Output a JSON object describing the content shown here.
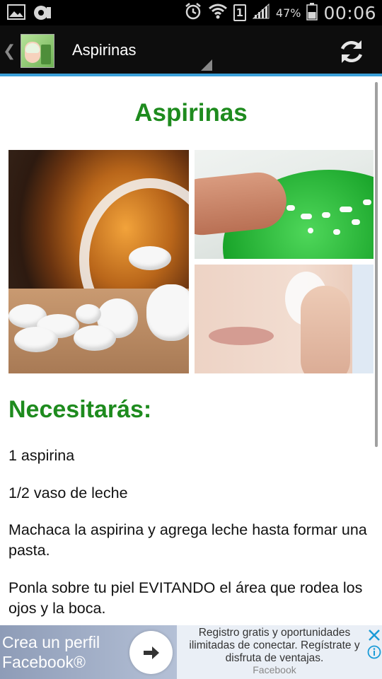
{
  "status_bar": {
    "time": "00:06",
    "battery_percent": "47%",
    "sim_slot": "1"
  },
  "action_bar": {
    "title": "Aspirinas"
  },
  "article": {
    "title": "Aspirinas",
    "section_heading": "Necesitarás:",
    "paragraphs": [
      "1 aspirina",
      "1/2 vaso de leche",
      "Machaca la aspirina y agrega leche hasta formar una pasta.",
      "Ponla sobre tu piel EVITANDO el área que rodea los ojos y la boca."
    ]
  },
  "ad": {
    "cta_line1": "Crea un perfil",
    "cta_line2": "Facebook®",
    "description": "Registro gratis y oportunidades ilimitadas de conectar. Regístrate y disfruta de ventajas.",
    "source": "Facebook"
  },
  "colors": {
    "accent_green": "#1e8b1e",
    "action_bar_underline": "#3a9fd8",
    "ad_icon_blue": "#1a9bd7"
  }
}
